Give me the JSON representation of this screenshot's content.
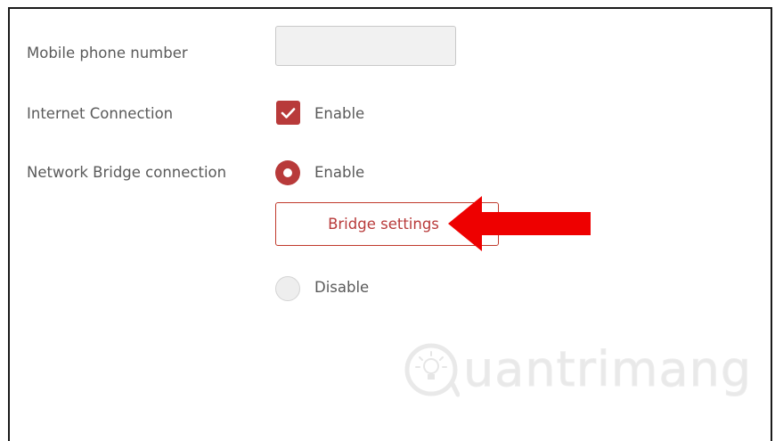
{
  "form": {
    "mobile_phone": {
      "label": "Mobile phone number",
      "value": "",
      "placeholder": ""
    },
    "internet_connection": {
      "label": "Internet Connection",
      "option_label": "Enable",
      "checked": true
    },
    "network_bridge": {
      "label": "Network Bridge connection",
      "enable_label": "Enable",
      "enable_selected": true,
      "settings_button_label": "Bridge settings",
      "disable_label": "Disable",
      "disable_selected": false
    }
  },
  "annotation": {
    "arrow_icon": "arrow-left-icon",
    "arrow_color": "#ee0000"
  },
  "watermark": {
    "logo_icon": "lightbulb-icon",
    "text": "uantrimang"
  },
  "colors": {
    "accent": "#b83a3a",
    "label_text": "#5a5a5a",
    "input_bg": "#f1f1f1"
  }
}
